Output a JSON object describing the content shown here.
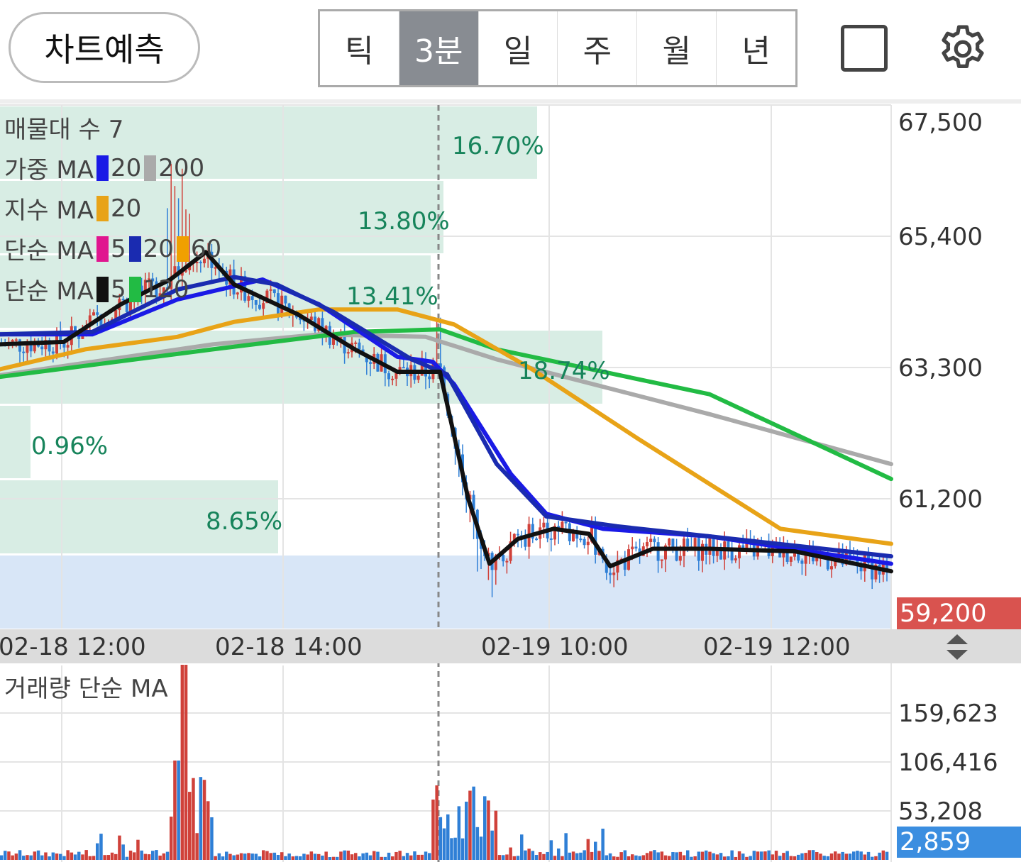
{
  "toolbar": {
    "predict_label": "차트예측",
    "periods": [
      "틱",
      "3분",
      "일",
      "주",
      "월",
      "년"
    ],
    "active_period": "3분",
    "icons": [
      "square-icon",
      "gear-icon"
    ]
  },
  "indicators": {
    "volume_profile": "매물대 수 7",
    "weighted_ma": {
      "label": "가중 MA",
      "items": [
        {
          "color": "#1a1ae6",
          "value": "20"
        },
        {
          "color": "#aaaaaa",
          "value": "200"
        }
      ]
    },
    "exp_ma": {
      "label": "지수 MA",
      "items": [
        {
          "color": "#e8a317",
          "value": "20"
        }
      ]
    },
    "simple_ma1": {
      "label": "단순 MA",
      "items": [
        {
          "color": "#e0168f",
          "value": "5"
        },
        {
          "color": "#1a2bb0",
          "value": "20"
        },
        {
          "color": "#f0a000",
          "value": "60"
        }
      ]
    },
    "simple_ma2": {
      "label": "단순 MA",
      "items": [
        {
          "color": "#111111",
          "value": "5"
        },
        {
          "color": "#22bb44",
          "value": "120"
        }
      ]
    }
  },
  "volume_profile_pcts": [
    "16.70%",
    "13.80%",
    "13.41%",
    "18.74%",
    "0.96%",
    "8.65%"
  ],
  "price_axis": {
    "ticks": [
      "67,500",
      "65,400",
      "63,300",
      "61,200"
    ],
    "current_price": "59,200"
  },
  "time_axis": {
    "labels": [
      "02-18 12:00",
      "02-18 14:00",
      "02-19 10:00",
      "02-19 12:00"
    ]
  },
  "volume_panel": {
    "title": "거래량 단순 MA",
    "ticks": [
      "159,623",
      "106,416",
      "53,208"
    ],
    "current_volume": "2,859"
  },
  "colors": {
    "up": "#d0413a",
    "down": "#2f7fd6",
    "profile": "#d8ede4",
    "current_zone": "#d8e6f7",
    "grid": "#e4e4e4"
  },
  "chart_data": {
    "type": "line",
    "title": "",
    "price_range": [
      58000,
      68500
    ],
    "ma_series": [
      {
        "color": "#aaaaaa",
        "points": [
          [
            0,
            63080
          ],
          [
            300,
            63700
          ],
          [
            450,
            63900
          ],
          [
            600,
            63850
          ],
          [
            700,
            63400
          ],
          [
            1000,
            62300
          ],
          [
            1256,
            61300
          ]
        ]
      },
      {
        "color": "#22bb44",
        "points": [
          [
            0,
            63050
          ],
          [
            300,
            63600
          ],
          [
            500,
            63950
          ],
          [
            620,
            64000
          ],
          [
            700,
            63600
          ],
          [
            1000,
            62700
          ],
          [
            1256,
            61000
          ]
        ]
      },
      {
        "color": "#e8a317",
        "points": [
          [
            0,
            63200
          ],
          [
            120,
            63600
          ],
          [
            250,
            63850
          ],
          [
            330,
            64150
          ],
          [
            450,
            64400
          ],
          [
            560,
            64400
          ],
          [
            640,
            64100
          ],
          [
            750,
            63200
          ],
          [
            900,
            61800
          ],
          [
            1100,
            60000
          ],
          [
            1256,
            59700
          ]
        ]
      },
      {
        "color": "#1a1ae6",
        "points": [
          [
            0,
            63900
          ],
          [
            130,
            63900
          ],
          [
            250,
            64600
          ],
          [
            370,
            65000
          ],
          [
            450,
            64500
          ],
          [
            560,
            63450
          ],
          [
            610,
            63350
          ],
          [
            640,
            62900
          ],
          [
            720,
            61100
          ],
          [
            770,
            60300
          ],
          [
            850,
            60000
          ],
          [
            1000,
            59850
          ],
          [
            1256,
            59300
          ]
        ]
      },
      {
        "color": "#1a2bb0",
        "points": [
          [
            0,
            63900
          ],
          [
            130,
            63950
          ],
          [
            250,
            64800
          ],
          [
            330,
            65050
          ],
          [
            390,
            64900
          ],
          [
            470,
            64350
          ],
          [
            580,
            63400
          ],
          [
            630,
            63100
          ],
          [
            700,
            61300
          ],
          [
            770,
            60250
          ],
          [
            870,
            60050
          ],
          [
            1000,
            59850
          ],
          [
            1256,
            59450
          ]
        ]
      },
      {
        "color": "#111111",
        "points": [
          [
            0,
            63700
          ],
          [
            90,
            63750
          ],
          [
            170,
            64500
          ],
          [
            240,
            65000
          ],
          [
            290,
            65550
          ],
          [
            330,
            64900
          ],
          [
            420,
            64300
          ],
          [
            500,
            63600
          ],
          [
            560,
            63150
          ],
          [
            620,
            63150
          ],
          [
            660,
            60600
          ],
          [
            690,
            59300
          ],
          [
            730,
            59800
          ],
          [
            780,
            60000
          ],
          [
            830,
            59900
          ],
          [
            860,
            59250
          ],
          [
            920,
            59600
          ],
          [
            1000,
            59600
          ],
          [
            1120,
            59550
          ],
          [
            1256,
            59150
          ]
        ]
      }
    ]
  }
}
